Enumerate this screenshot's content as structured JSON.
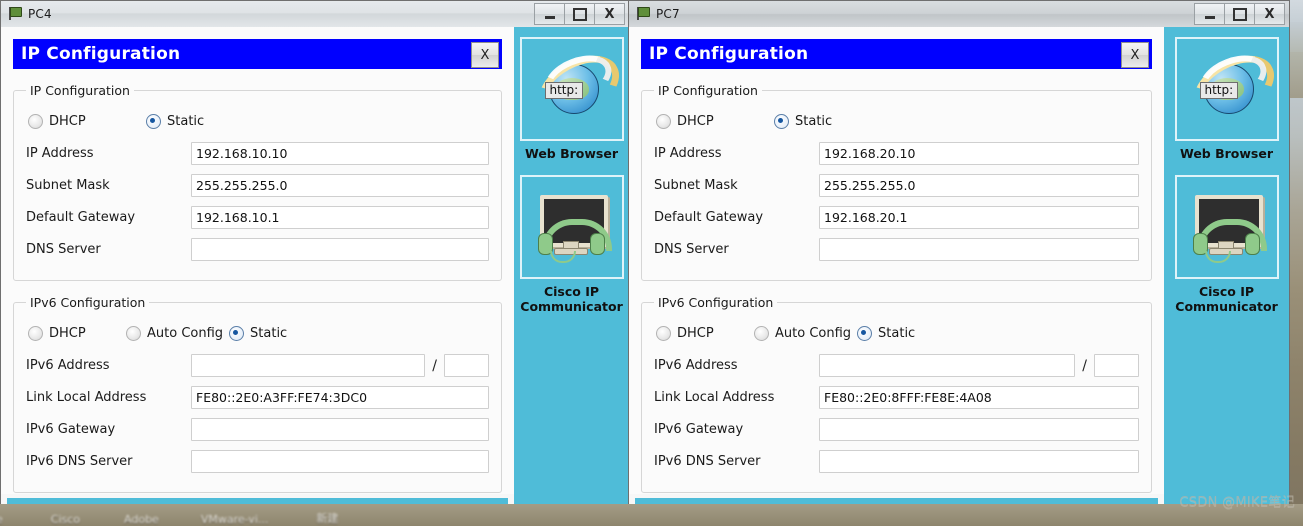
{
  "desktop": {
    "icon_labels": [
      "e",
      "Cisco",
      "Adobe",
      "VMware-vi...",
      "新建"
    ],
    "watermark": "CSDN @MIKE笔记"
  },
  "windows": [
    {
      "name": "pc4",
      "title": "PC4",
      "title_icon": "packet-tracer-flag-icon",
      "controls": {
        "minimize": "–",
        "maximize": "□",
        "close": "X"
      },
      "dialog": {
        "header": "IP Configuration",
        "close_label": "X",
        "ipv4": {
          "legend": "IP Configuration",
          "modes": [
            {
              "label": "DHCP",
              "selected": false
            },
            {
              "label": "Static",
              "selected": true
            }
          ],
          "fields": [
            {
              "label": "IP Address",
              "value": "192.168.10.10"
            },
            {
              "label": "Subnet Mask",
              "value": "255.255.255.0"
            },
            {
              "label": "Default Gateway",
              "value": "192.168.10.1"
            },
            {
              "label": "DNS Server",
              "value": ""
            }
          ]
        },
        "ipv6": {
          "legend": "IPv6 Configuration",
          "modes": [
            {
              "label": "DHCP",
              "selected": false
            },
            {
              "label": "Auto Config",
              "selected": false
            },
            {
              "label": "Static",
              "selected": true
            }
          ],
          "address": {
            "label": "IPv6 Address",
            "value": "",
            "separator": "/",
            "prefix": ""
          },
          "fields": [
            {
              "label": "Link Local Address",
              "value": "FE80::2E0:A3FF:FE74:3DC0"
            },
            {
              "label": "IPv6 Gateway",
              "value": ""
            },
            {
              "label": "IPv6 DNS Server",
              "value": ""
            }
          ]
        }
      },
      "apps": [
        {
          "icon": "web-browser-icon",
          "badge": "http:",
          "label": "Web Browser"
        },
        {
          "icon": "cisco-ip-communicator-icon",
          "label": "Cisco IP\nCommunicator"
        }
      ]
    },
    {
      "name": "pc7",
      "title": "PC7",
      "title_icon": "packet-tracer-flag-icon",
      "controls": {
        "minimize": "–",
        "maximize": "□",
        "close": "X"
      },
      "dialog": {
        "header": "IP Configuration",
        "close_label": "X",
        "ipv4": {
          "legend": "IP Configuration",
          "modes": [
            {
              "label": "DHCP",
              "selected": false
            },
            {
              "label": "Static",
              "selected": true
            }
          ],
          "fields": [
            {
              "label": "IP Address",
              "value": "192.168.20.10"
            },
            {
              "label": "Subnet Mask",
              "value": "255.255.255.0"
            },
            {
              "label": "Default Gateway",
              "value": "192.168.20.1"
            },
            {
              "label": "DNS Server",
              "value": ""
            }
          ]
        },
        "ipv6": {
          "legend": "IPv6 Configuration",
          "modes": [
            {
              "label": "DHCP",
              "selected": false
            },
            {
              "label": "Auto Config",
              "selected": false
            },
            {
              "label": "Static",
              "selected": true
            }
          ],
          "address": {
            "label": "IPv6 Address",
            "value": "",
            "separator": "/",
            "prefix": ""
          },
          "fields": [
            {
              "label": "Link Local Address",
              "value": "FE80::2E0:8FFF:FE8E:4A08"
            },
            {
              "label": "IPv6 Gateway",
              "value": ""
            },
            {
              "label": "IPv6 DNS Server",
              "value": ""
            }
          ]
        }
      },
      "apps": [
        {
          "icon": "web-browser-icon",
          "badge": "http:",
          "label": "Web Browser"
        },
        {
          "icon": "cisco-ip-communicator-icon",
          "label": "Cisco IP\nCommunicator"
        }
      ]
    }
  ],
  "colors": {
    "dialog_header": "#0000ff",
    "panel_teal": "#4fbcd8",
    "radio_selected": "#1556a0"
  }
}
